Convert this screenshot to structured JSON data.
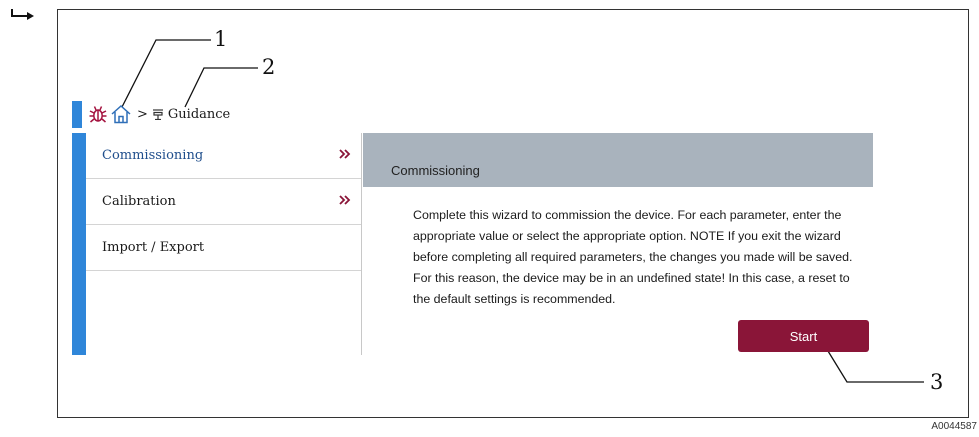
{
  "callouts": {
    "c1": "1",
    "c2": "2",
    "c3": "3"
  },
  "figure_id": "A0044587",
  "breadcrumb": {
    "icons": [
      "bug-icon",
      "home-icon",
      "guidance-icon"
    ],
    "separator": ">",
    "current": "Guidance"
  },
  "sidebar": {
    "items": [
      {
        "label": "Commissioning",
        "active": true,
        "has_chevron": true
      },
      {
        "label": "Calibration",
        "active": false,
        "has_chevron": true
      },
      {
        "label": "Import / Export",
        "active": false,
        "has_chevron": false
      }
    ]
  },
  "panel": {
    "title": "Commissioning",
    "description": "Complete this wizard to commission the device. For each parameter, enter the appropriate value or select the appropriate option. NOTE If you exit the wizard before completing all required parameters, the changes you made will be saved. For this reason, the device may be in an undefined state! In this case, a reset to the default settings is recommended.",
    "start_label": "Start"
  },
  "colors": {
    "accent_blue": "#2f86d9",
    "brand_red": "#8a1538",
    "header_gray": "#a9b3bd"
  }
}
